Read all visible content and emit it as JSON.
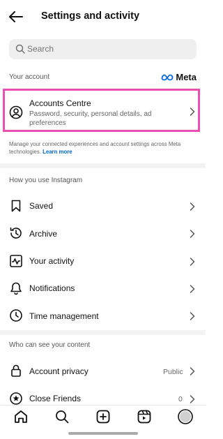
{
  "header": {
    "title": "Settings and activity"
  },
  "search": {
    "placeholder": "Search"
  },
  "your_account": {
    "label": "Your account",
    "brand": "Meta",
    "accounts_centre": {
      "title": "Accounts Centre",
      "subtitle": "Password, security, personal details, ad preferences"
    },
    "note": "Manage your connected experiences and account settings across Meta technologies.",
    "learn_more": "Learn more"
  },
  "how_you_use": {
    "label": "How you use Instagram",
    "items": [
      {
        "label": "Saved",
        "icon": "bookmark-icon"
      },
      {
        "label": "Archive",
        "icon": "archive-icon"
      },
      {
        "label": "Your activity",
        "icon": "activity-icon"
      },
      {
        "label": "Notifications",
        "icon": "bell-icon"
      },
      {
        "label": "Time management",
        "icon": "clock-icon"
      }
    ]
  },
  "who_can_see": {
    "label": "Who can see your content",
    "items": [
      {
        "label": "Account privacy",
        "value": "Public",
        "icon": "lock-icon"
      },
      {
        "label": "Close Friends",
        "value": "0",
        "icon": "star-icon"
      }
    ]
  },
  "bottom_nav": [
    "home-icon",
    "search-icon",
    "create-icon",
    "reels-icon",
    "profile-icon"
  ],
  "colors": {
    "highlight": "#ea4fb4",
    "link": "#0064d1",
    "meta_blue": "#0668e1"
  }
}
